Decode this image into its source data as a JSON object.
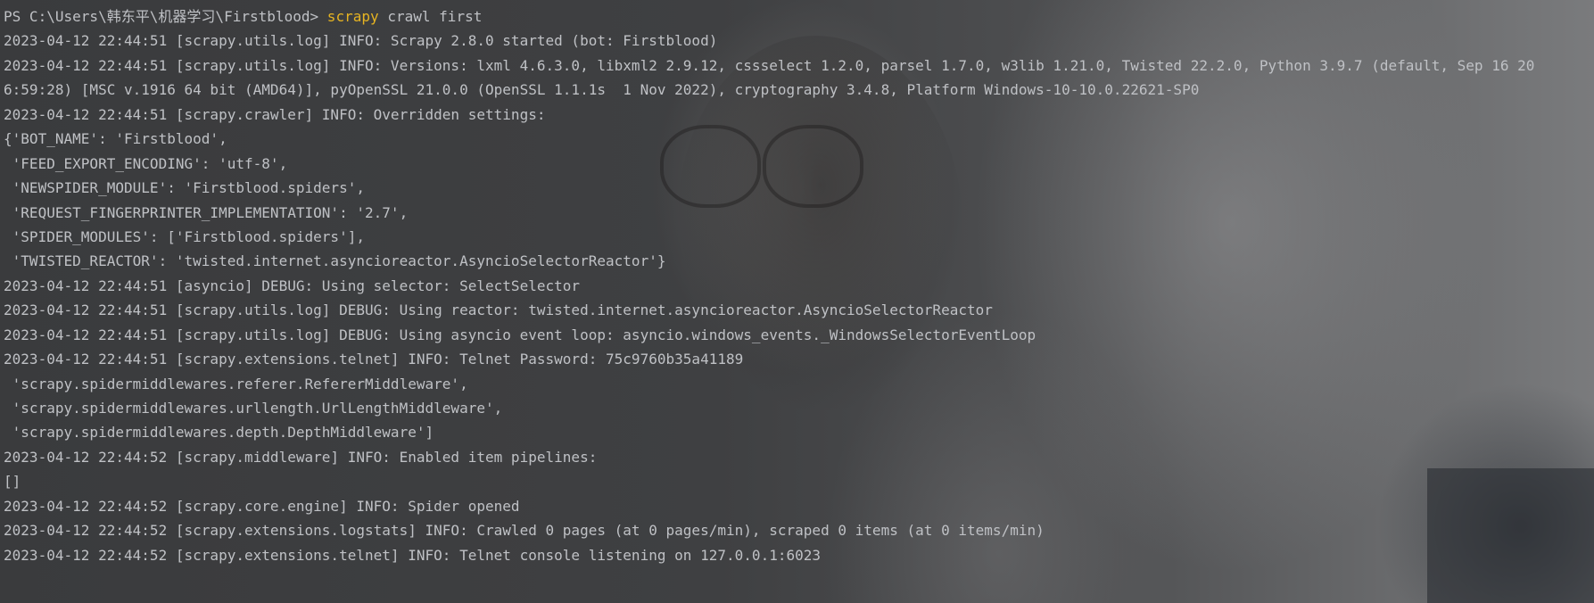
{
  "terminal": {
    "prompt": "PS C:\\Users\\韩东平\\机器学习\\Firstblood>",
    "command": "scrapy",
    "command_args": "crawl first",
    "lines": [
      "2023-04-12 22:44:51 [scrapy.utils.log] INFO: Scrapy 2.8.0 started (bot: Firstblood)",
      "2023-04-12 22:44:51 [scrapy.utils.log] INFO: Versions: lxml 4.6.3.0, libxml2 2.9.12, cssselect 1.2.0, parsel 1.7.0, w3lib 1.21.0, Twisted 22.2.0, Python 3.9.7 (default, Sep 16 20",
      "6:59:28) [MSC v.1916 64 bit (AMD64)], pyOpenSSL 21.0.0 (OpenSSL 1.1.1s  1 Nov 2022), cryptography 3.4.8, Platform Windows-10-10.0.22621-SP0",
      "2023-04-12 22:44:51 [scrapy.crawler] INFO: Overridden settings:",
      "{'BOT_NAME': 'Firstblood',",
      " 'FEED_EXPORT_ENCODING': 'utf-8',",
      " 'NEWSPIDER_MODULE': 'Firstblood.spiders',",
      " 'REQUEST_FINGERPRINTER_IMPLEMENTATION': '2.7',",
      " 'SPIDER_MODULES': ['Firstblood.spiders'],",
      " 'TWISTED_REACTOR': 'twisted.internet.asyncioreactor.AsyncioSelectorReactor'}",
      "2023-04-12 22:44:51 [asyncio] DEBUG: Using selector: SelectSelector",
      "2023-04-12 22:44:51 [scrapy.utils.log] DEBUG: Using reactor: twisted.internet.asyncioreactor.AsyncioSelectorReactor",
      "2023-04-12 22:44:51 [scrapy.utils.log] DEBUG: Using asyncio event loop: asyncio.windows_events._WindowsSelectorEventLoop",
      "2023-04-12 22:44:51 [scrapy.extensions.telnet] INFO: Telnet Password: 75c9760b35a41189",
      " 'scrapy.spidermiddlewares.referer.RefererMiddleware',",
      " 'scrapy.spidermiddlewares.urllength.UrlLengthMiddleware',",
      " 'scrapy.spidermiddlewares.depth.DepthMiddleware']",
      "2023-04-12 22:44:52 [scrapy.middleware] INFO: Enabled item pipelines:",
      "[]",
      "2023-04-12 22:44:52 [scrapy.core.engine] INFO: Spider opened",
      "2023-04-12 22:44:52 [scrapy.extensions.logstats] INFO: Crawled 0 pages (at 0 pages/min), scraped 0 items (at 0 items/min)",
      "2023-04-12 22:44:52 [scrapy.extensions.telnet] INFO: Telnet console listening on 127.0.0.1:6023"
    ]
  },
  "colors": {
    "text": "#bfc1c5",
    "command": "#e6b422"
  }
}
